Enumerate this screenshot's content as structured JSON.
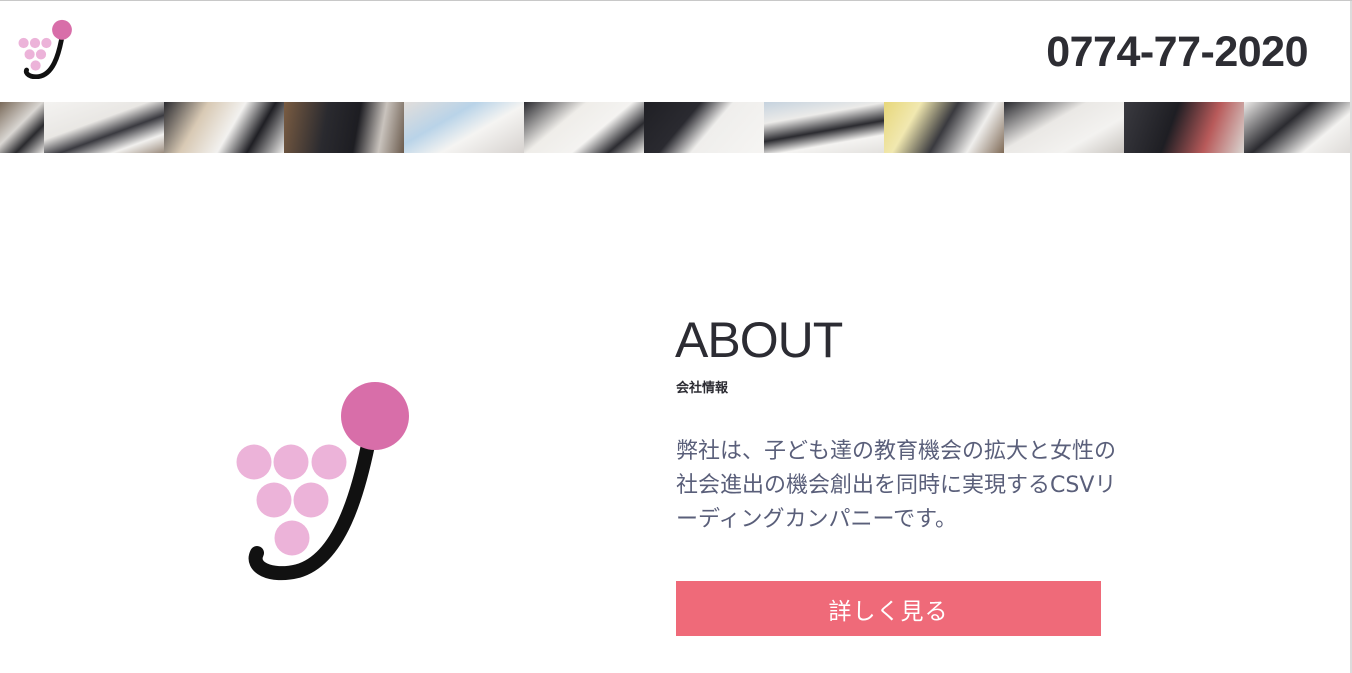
{
  "header": {
    "phone": "0774-77-2020"
  },
  "about": {
    "title": "ABOUT",
    "subtitle": "会社情報",
    "text_lines": [
      "弊社は、子ども達の教育機会の拡大と女性の",
      "社会進出の機会創出を同時に実現するCSVリ",
      "ーディングカンパニーです。"
    ],
    "more_button": "詳しく見る"
  },
  "colors": {
    "accent_pink": "#d86ea9",
    "grape_pink": "#ecb3d9",
    "button": "#ef6a79",
    "text_dark": "#2c2c33",
    "text_body": "#5a5f7a"
  },
  "photo_strip": {
    "tile_count": 12
  }
}
